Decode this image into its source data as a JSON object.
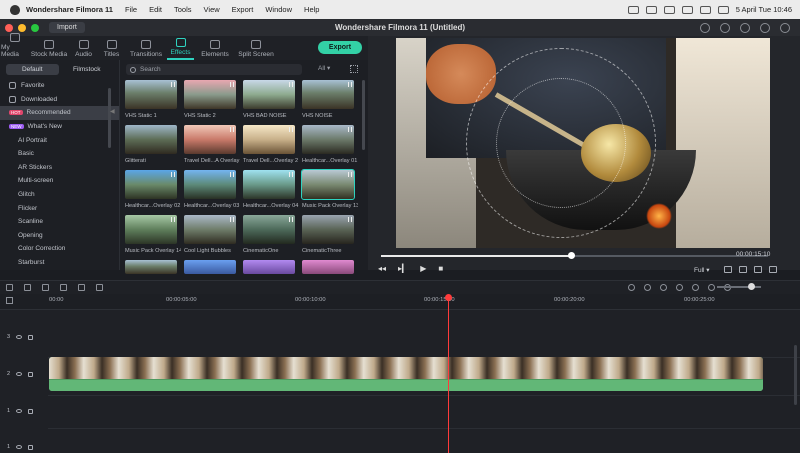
{
  "menubar": {
    "app": "Wondershare Filmora 11",
    "menus": [
      "File",
      "Edit",
      "Tools",
      "View",
      "Export",
      "Window",
      "Help"
    ],
    "datetime": "5 April Tue 10:46"
  },
  "window": {
    "title": "Wondershare Filmora 11 (Untitled)",
    "import_label": "Import"
  },
  "toolbar": {
    "tabs": [
      "My Media",
      "Stock Media",
      "Audio",
      "Titles",
      "Transitions",
      "Effects",
      "Elements",
      "Split Screen"
    ],
    "active_tab": "Effects",
    "export_label": "Export"
  },
  "effects_panel": {
    "segments": [
      "Default",
      "Filmstock"
    ],
    "categories_top": [
      "Favorite",
      "Downloaded",
      "Recommended",
      "What's New"
    ],
    "categories_sub": [
      "AI Portrait",
      "Basic",
      "AR Stickers",
      "Multi-screen",
      "Glitch",
      "Flicker",
      "Scanline",
      "Opening",
      "Color Correction",
      "Starburst"
    ],
    "badges": {
      "hot": "HOT",
      "new": "NEW"
    },
    "search_placeholder": "Search",
    "filter": "All",
    "items": [
      "VHS Static 1",
      "VHS Static 2",
      "VHS BAD NOISE",
      "VHS NOISE",
      "Glitterati",
      "Travel Dell...A Overlay 1",
      "Travel Dell...Overlay 2",
      "Healthcar...Overlay 01",
      "Healthcar...Overlay 02",
      "Healthcar...Overlay 03",
      "Healthcar...Overlay 04",
      "Music Pack Overlay 13",
      "Music Pack Overlay 14",
      "Cool Light Bubbles",
      "CinematicOne",
      "CinematicThree",
      "",
      "",
      "",
      ""
    ]
  },
  "player": {
    "timecode": "00:00:15:10",
    "quality": "Full",
    "progress": 0.49
  },
  "timeline": {
    "ruler": [
      "00:00",
      "00:00:05:00",
      "00:00:10:00",
      "00:00:15:00",
      "00:00:20:00",
      "00:00:25:00"
    ],
    "tracks": [
      "3",
      "2",
      "1",
      "1"
    ]
  },
  "colors": {
    "accent": "#2fd3c0",
    "export": "#33d1a6",
    "playhead": "#ff3b3b",
    "audio": "#62b777"
  }
}
